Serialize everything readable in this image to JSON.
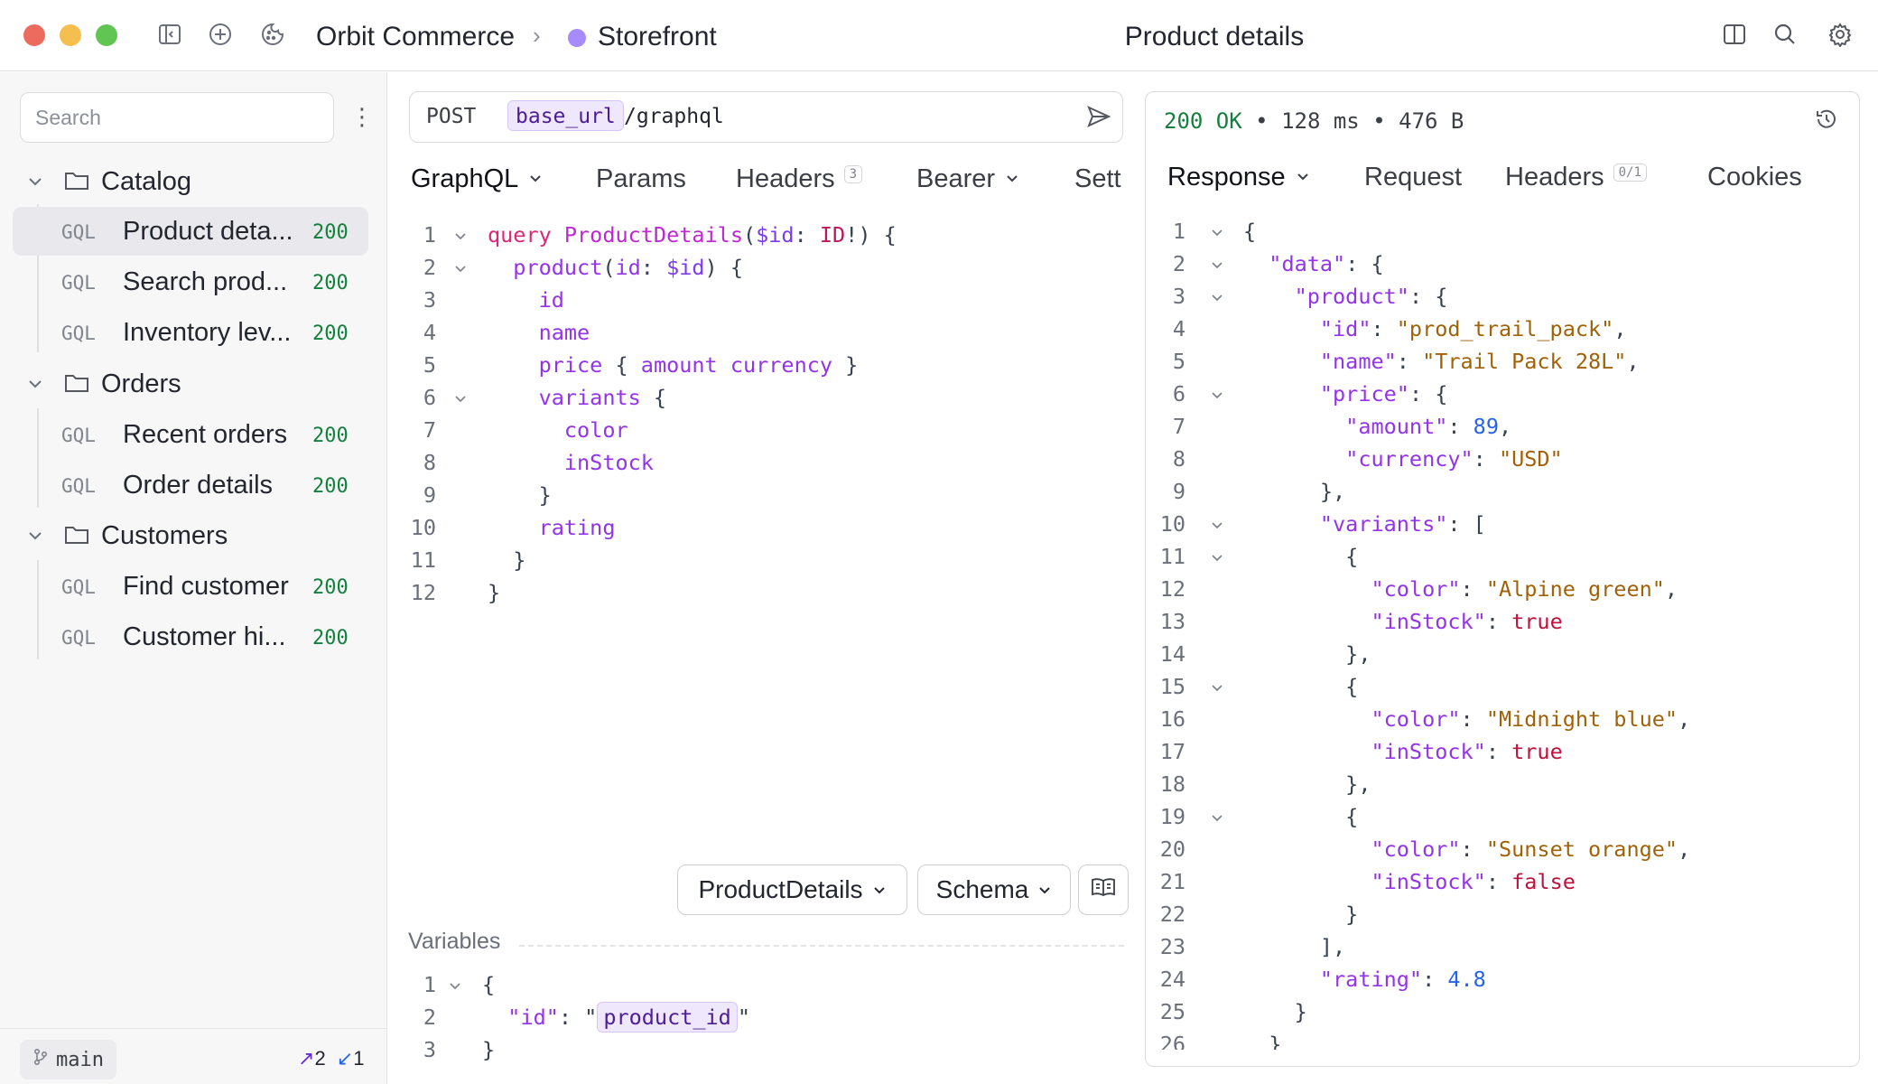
{
  "titlebar": {
    "workspace": "Orbit Commerce",
    "environment": "Storefront",
    "environment_color": "#a78bfa",
    "page_title": "Product details",
    "left_icons": [
      "sidebar-toggle-icon",
      "add-circle-icon",
      "cookie-icon"
    ],
    "right_icons": [
      "split-view-icon",
      "search-icon",
      "gear-icon"
    ]
  },
  "sidebar": {
    "search_placeholder": "Search",
    "folders": [
      {
        "name": "Catalog",
        "requests": [
          {
            "type": "GQL",
            "name": "Product deta...",
            "status": "200",
            "active": true
          },
          {
            "type": "GQL",
            "name": "Search prod...",
            "status": "200"
          },
          {
            "type": "GQL",
            "name": "Inventory lev...",
            "status": "200"
          }
        ]
      },
      {
        "name": "Orders",
        "requests": [
          {
            "type": "GQL",
            "name": "Recent orders",
            "status": "200"
          },
          {
            "type": "GQL",
            "name": "Order details",
            "status": "200"
          }
        ]
      },
      {
        "name": "Customers",
        "requests": [
          {
            "type": "GQL",
            "name": "Find customer",
            "status": "200"
          },
          {
            "type": "GQL",
            "name": "Customer hi...",
            "status": "200"
          }
        ]
      }
    ],
    "footer": {
      "branch": "main",
      "ahead": "2",
      "behind": "1"
    }
  },
  "request": {
    "method": "POST",
    "url_variable": "base_url",
    "url_path": "/graphql",
    "tabs": [
      {
        "label": "GraphQL",
        "dropdown": true
      },
      {
        "label": "Params"
      },
      {
        "label": "Headers",
        "count": "3"
      },
      {
        "label": "Bearer",
        "dropdown": true
      },
      {
        "label": "Sett"
      }
    ],
    "query_lines": [
      [
        [
          "kw",
          "query "
        ],
        [
          "fn",
          "ProductDetails"
        ],
        [
          "pu",
          "("
        ],
        [
          "vv",
          "$id"
        ],
        [
          "pu",
          ": "
        ],
        [
          "ty",
          "ID"
        ],
        [
          "pu",
          "!) {"
        ]
      ],
      [
        [
          "pu",
          "  "
        ],
        [
          "fld",
          "product"
        ],
        [
          "pu",
          "("
        ],
        [
          "fld",
          "id"
        ],
        [
          "pu",
          ": "
        ],
        [
          "vv",
          "$id"
        ],
        [
          "pu",
          ") {"
        ]
      ],
      [
        [
          "pu",
          "    "
        ],
        [
          "fld",
          "id"
        ]
      ],
      [
        [
          "pu",
          "    "
        ],
        [
          "fld",
          "name"
        ]
      ],
      [
        [
          "pu",
          "    "
        ],
        [
          "fld",
          "price"
        ],
        [
          "pu",
          " { "
        ],
        [
          "fld",
          "amount"
        ],
        [
          "pu",
          " "
        ],
        [
          "fld",
          "currency"
        ],
        [
          "pu",
          " }"
        ]
      ],
      [
        [
          "pu",
          "    "
        ],
        [
          "fld",
          "variants"
        ],
        [
          "pu",
          " {"
        ]
      ],
      [
        [
          "pu",
          "      "
        ],
        [
          "fld",
          "color"
        ]
      ],
      [
        [
          "pu",
          "      "
        ],
        [
          "fld",
          "inStock"
        ]
      ],
      [
        [
          "pu",
          "    }"
        ]
      ],
      [
        [
          "pu",
          "    "
        ],
        [
          "fld",
          "rating"
        ]
      ],
      [
        [
          "pu",
          "  }"
        ]
      ],
      [
        [
          "pu",
          "}"
        ]
      ]
    ],
    "query_folds": [
      1,
      2,
      6
    ],
    "operation_select": "ProductDetails",
    "schema_select": "Schema",
    "variables_title": "Variables",
    "variables_lines": [
      [
        [
          "pu",
          "{"
        ]
      ],
      [
        [
          "pu",
          "  "
        ],
        [
          "jk",
          "\"id\""
        ],
        [
          "pu",
          ": \""
        ],
        [
          "chip",
          "product_id"
        ],
        [
          "pu",
          "\""
        ]
      ],
      [
        [
          "pu",
          "}"
        ]
      ]
    ]
  },
  "response": {
    "status_code": "200 OK",
    "time": "128 ms",
    "size": "476 B",
    "tabs": [
      {
        "label": "Response",
        "dropdown": true
      },
      {
        "label": "Request"
      },
      {
        "label": "Headers",
        "count": "0/1"
      },
      {
        "label": "Cookies"
      }
    ],
    "lines": [
      [
        [
          "pu",
          "{"
        ]
      ],
      [
        [
          "pu",
          "  "
        ],
        [
          "jk",
          "\"data\""
        ],
        [
          "pu",
          ": {"
        ]
      ],
      [
        [
          "pu",
          "    "
        ],
        [
          "jk",
          "\"product\""
        ],
        [
          "pu",
          ": {"
        ]
      ],
      [
        [
          "pu",
          "      "
        ],
        [
          "jk",
          "\"id\""
        ],
        [
          "pu",
          ": "
        ],
        [
          "js",
          "\"prod_trail_pack\""
        ],
        [
          "pu",
          ","
        ]
      ],
      [
        [
          "pu",
          "      "
        ],
        [
          "jk",
          "\"name\""
        ],
        [
          "pu",
          ": "
        ],
        [
          "js",
          "\"Trail Pack 28L\""
        ],
        [
          "pu",
          ","
        ]
      ],
      [
        [
          "pu",
          "      "
        ],
        [
          "jk",
          "\"price\""
        ],
        [
          "pu",
          ": {"
        ]
      ],
      [
        [
          "pu",
          "        "
        ],
        [
          "jk",
          "\"amount\""
        ],
        [
          "pu",
          ": "
        ],
        [
          "jn",
          "89"
        ],
        [
          "pu",
          ","
        ]
      ],
      [
        [
          "pu",
          "        "
        ],
        [
          "jk",
          "\"currency\""
        ],
        [
          "pu",
          ": "
        ],
        [
          "js",
          "\"USD\""
        ]
      ],
      [
        [
          "pu",
          "      },"
        ]
      ],
      [
        [
          "pu",
          "      "
        ],
        [
          "jk",
          "\"variants\""
        ],
        [
          "pu",
          ": ["
        ]
      ],
      [
        [
          "pu",
          "        {"
        ]
      ],
      [
        [
          "pu",
          "          "
        ],
        [
          "jk",
          "\"color\""
        ],
        [
          "pu",
          ": "
        ],
        [
          "js",
          "\"Alpine green\""
        ],
        [
          "pu",
          ","
        ]
      ],
      [
        [
          "pu",
          "          "
        ],
        [
          "jk",
          "\"inStock\""
        ],
        [
          "pu",
          ": "
        ],
        [
          "jb",
          "true"
        ]
      ],
      [
        [
          "pu",
          "        },"
        ]
      ],
      [
        [
          "pu",
          "        {"
        ]
      ],
      [
        [
          "pu",
          "          "
        ],
        [
          "jk",
          "\"color\""
        ],
        [
          "pu",
          ": "
        ],
        [
          "js",
          "\"Midnight blue\""
        ],
        [
          "pu",
          ","
        ]
      ],
      [
        [
          "pu",
          "          "
        ],
        [
          "jk",
          "\"inStock\""
        ],
        [
          "pu",
          ": "
        ],
        [
          "jb",
          "true"
        ]
      ],
      [
        [
          "pu",
          "        },"
        ]
      ],
      [
        [
          "pu",
          "        {"
        ]
      ],
      [
        [
          "pu",
          "          "
        ],
        [
          "jk",
          "\"color\""
        ],
        [
          "pu",
          ": "
        ],
        [
          "js",
          "\"Sunset orange\""
        ],
        [
          "pu",
          ","
        ]
      ],
      [
        [
          "pu",
          "          "
        ],
        [
          "jk",
          "\"inStock\""
        ],
        [
          "pu",
          ": "
        ],
        [
          "jb",
          "false"
        ]
      ],
      [
        [
          "pu",
          "        }"
        ]
      ],
      [
        [
          "pu",
          "      ],"
        ]
      ],
      [
        [
          "pu",
          "      "
        ],
        [
          "jk",
          "\"rating\""
        ],
        [
          "pu",
          ": "
        ],
        [
          "jn",
          "4.8"
        ]
      ],
      [
        [
          "pu",
          "    }"
        ]
      ],
      [
        [
          "pu",
          "  }"
        ]
      ]
    ],
    "folds": [
      1,
      2,
      3,
      6,
      10,
      11,
      15,
      19
    ]
  }
}
